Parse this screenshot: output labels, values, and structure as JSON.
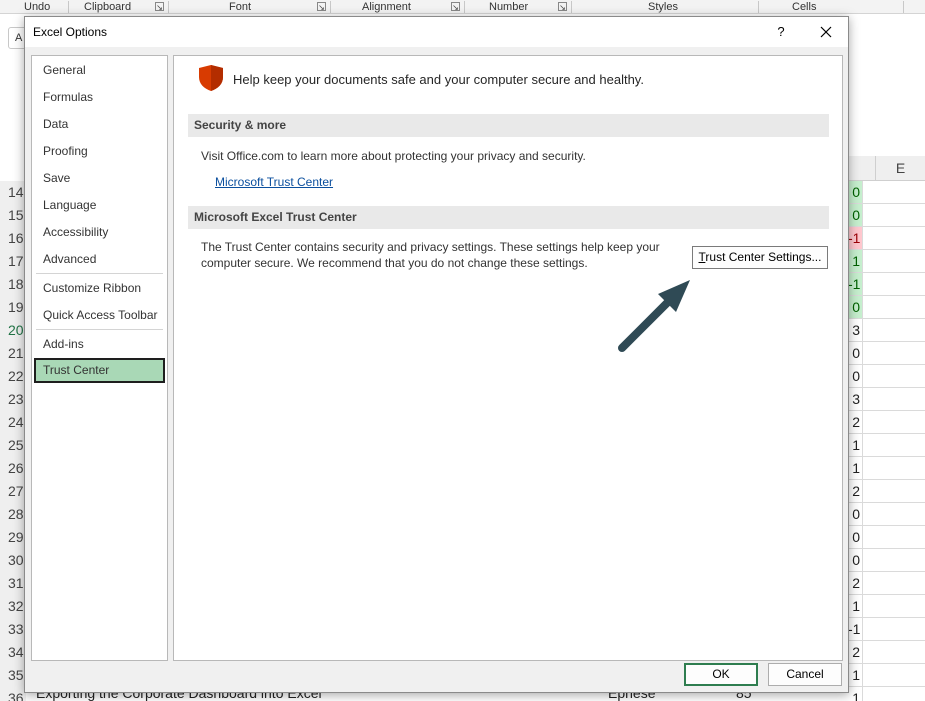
{
  "excel_background": {
    "ribbon_groups": [
      "Undo",
      "Clipboard",
      "Font",
      "Alignment",
      "Number",
      "Styles",
      "Cells"
    ],
    "namebox_fragment": "A",
    "column_header": "E",
    "row_numbers": [
      "14",
      "15",
      "16",
      "17",
      "18",
      "19",
      "20",
      "21",
      "22",
      "23",
      "24",
      "25",
      "26",
      "27",
      "28",
      "29",
      "30",
      "31",
      "32",
      "33",
      "34",
      "35",
      "36"
    ],
    "selected_row": "20",
    "column_d_values": [
      "0",
      "0",
      "-1",
      "1",
      "-1",
      "0",
      "3",
      "0",
      "0",
      "3",
      "2",
      "1",
      "1",
      "2",
      "0",
      "0",
      "0",
      "2",
      "1",
      "-1",
      "2",
      "1",
      "1"
    ],
    "column_d_fill": [
      "green",
      "green",
      "red",
      "green",
      "green",
      "green",
      "none",
      "none",
      "none",
      "none",
      "none",
      "none",
      "none",
      "none",
      "none",
      "none",
      "none",
      "none",
      "none",
      "none",
      "none",
      "none",
      "none"
    ],
    "bottom_row": {
      "title": "Exporting the Corporate Dashboard into Excel",
      "col3": "Ephese",
      "col4": "85"
    }
  },
  "dialog": {
    "title": "Excel Options",
    "help_label": "?",
    "nav": {
      "items": [
        "General",
        "Formulas",
        "Data",
        "Proofing",
        "Save",
        "Language",
        "Accessibility",
        "Advanced",
        "Customize Ribbon",
        "Quick Access Toolbar",
        "Add-ins",
        "Trust Center"
      ],
      "selected": "Trust Center"
    },
    "panel": {
      "intro": "Help keep your documents safe and your computer secure and healthy.",
      "security_section": {
        "heading": "Security & more",
        "text": "Visit Office.com to learn more about protecting your privacy and security.",
        "link": "Microsoft Trust Center"
      },
      "trust_center_section": {
        "heading": "Microsoft Excel Trust Center",
        "text": "The Trust Center contains security and privacy settings. These settings help keep your computer secure. We recommend that you do not change these settings.",
        "button_accel": "T",
        "button_rest": "rust Center Settings..."
      }
    },
    "ok_label": "OK",
    "cancel_label": "Cancel"
  },
  "colors": {
    "selected_nav_bg": "#a9d8b6",
    "ok_border": "#2e7d4f",
    "link": "#0b4f9e",
    "shield": "#d83b01",
    "arrow": "#2f4a55"
  }
}
